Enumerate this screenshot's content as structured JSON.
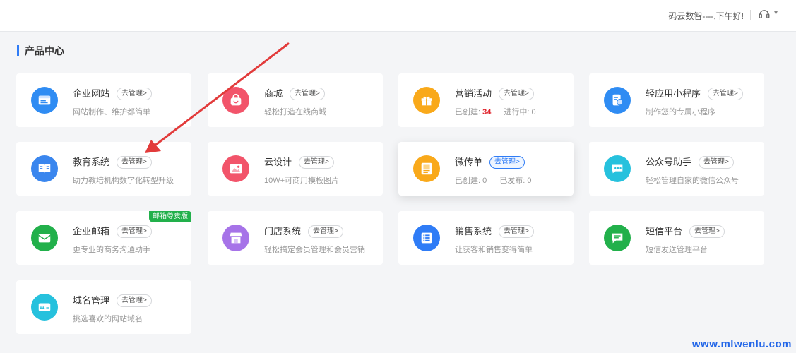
{
  "header": {
    "greeting": "码云数智----,下午好!",
    "support_icon": "headset-icon",
    "caret_icon": "chevron-down-icon"
  },
  "section": {
    "title": "产品中心"
  },
  "manage_label": "去管理>",
  "cards": [
    {
      "name": "企业网站",
      "desc": "网站制作、维护都简单",
      "icon": "browser-window-icon",
      "color": "#2f8cf3"
    },
    {
      "name": "商城",
      "desc": "轻松打造在线商城",
      "icon": "shopping-bag-icon",
      "color": "#f2546a"
    },
    {
      "name": "营销活动",
      "icon": "gift-icon",
      "color": "#f9a91a",
      "stats": [
        {
          "label": "已创建:",
          "value": "34"
        },
        {
          "label": "进行中:",
          "value": "0"
        }
      ]
    },
    {
      "name": "轻应用小程序",
      "desc": "制作您的专属小程序",
      "icon": "mini-program-icon",
      "color": "#2f8cf3"
    },
    {
      "name": "教育系统",
      "desc": "助力教培机构数字化转型升级",
      "icon": "book-icon",
      "color": "#3a86ee"
    },
    {
      "name": "云设计",
      "desc": "10W+可商用模板图片",
      "icon": "image-icon",
      "color": "#f2546a"
    },
    {
      "name": "微传单",
      "icon": "flyer-icon",
      "color": "#f9a91a",
      "stats": [
        {
          "label": "已创建:",
          "value": "0"
        },
        {
          "label": "已发布:",
          "value": "0"
        }
      ]
    },
    {
      "name": "公众号助手",
      "desc": "轻松管理自家的微信公众号",
      "icon": "chat-bubble-icon",
      "color": "#26c1dd"
    },
    {
      "name": "企业邮箱",
      "desc": "更专业的商务沟通助手",
      "icon": "mail-icon",
      "color": "#22b04b",
      "badge": "邮箱尊贵版"
    },
    {
      "name": "门店系统",
      "desc": "轻松搞定会员管理和会员营销",
      "icon": "store-icon",
      "color": "#a673e8"
    },
    {
      "name": "销售系统",
      "desc": "让获客和销售变得简单",
      "icon": "list-icon",
      "color": "#2f7cf6"
    },
    {
      "name": "短信平台",
      "desc": "短信发送管理平台",
      "icon": "message-icon",
      "color": "#22b04b"
    },
    {
      "name": "域名管理",
      "desc": "挑选喜欢的网站域名",
      "icon": "domain-icon",
      "color": "#26c1dd"
    }
  ],
  "watermark": "www.mlwenlu.com"
}
